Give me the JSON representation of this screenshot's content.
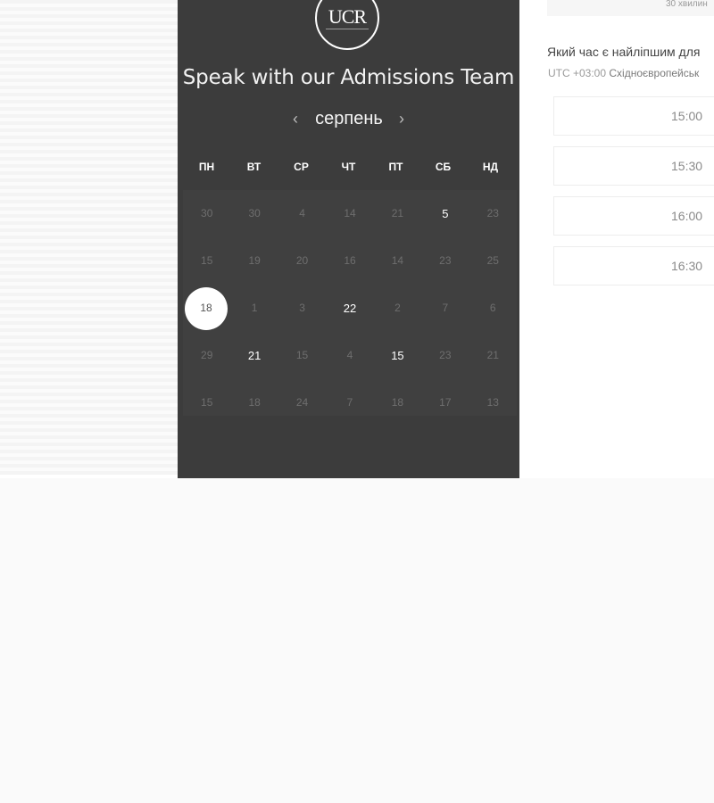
{
  "brand": {
    "logo_text": "UCR"
  },
  "panel": {
    "title": "Speak with our Admissions Team",
    "month": "серпень",
    "prev_icon": "‹",
    "next_icon": "›"
  },
  "calendar": {
    "weekdays": [
      "ПН",
      "ВТ",
      "СР",
      "ЧТ",
      "ПТ",
      "СБ",
      "НД"
    ],
    "selected_day": "18",
    "rows": [
      [
        "30",
        "30",
        "4",
        "14",
        "21",
        "5",
        "23"
      ],
      [
        "15",
        "19",
        "20",
        "16",
        "14",
        "23",
        "25"
      ],
      [
        "18",
        "1",
        "3",
        "22",
        "2",
        "7",
        "6"
      ],
      [
        "29",
        "21",
        "15",
        "4",
        "15",
        "23",
        "21"
      ],
      [
        "15",
        "18",
        "24",
        "7",
        "18",
        "17",
        "13"
      ]
    ],
    "available": [
      "0-5",
      "2-3",
      "3-1",
      "3-4"
    ]
  },
  "schedule": {
    "duration": "30 хвилин",
    "question": "Який час є найліпшим для",
    "timezone_offset": "UTC +03:00",
    "timezone_name": "Східноєвропейськ",
    "slots": [
      "15:00",
      "15:30",
      "16:00",
      "16:30"
    ]
  }
}
